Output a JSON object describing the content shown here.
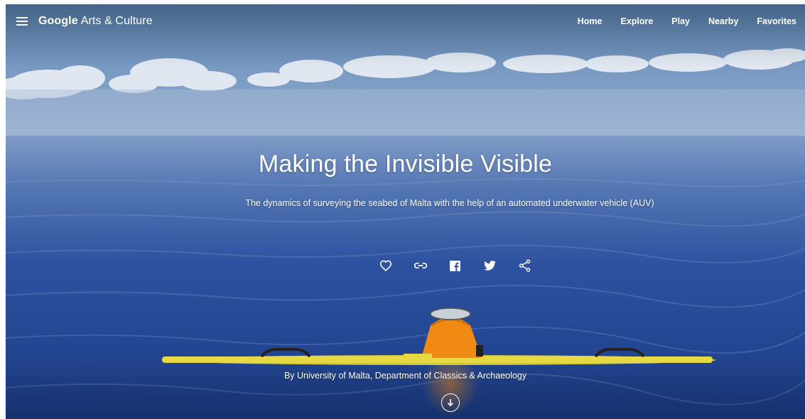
{
  "header": {
    "menu_icon": "hamburger-menu-icon",
    "logo_brand": "Google",
    "logo_product": "Arts & Culture",
    "nav": [
      {
        "label": "Home"
      },
      {
        "label": "Explore"
      },
      {
        "label": "Play"
      },
      {
        "label": "Nearby"
      },
      {
        "label": "Favorites"
      }
    ]
  },
  "story": {
    "title": "Making the Invisible Visible",
    "subtitle": "The dynamics of surveying the seabed of Malta with the help of an automated underwater vehicle (AUV)",
    "credit": "By University of Malta, Department of Classics & Archaeology"
  },
  "actions": [
    {
      "icon": "heart-icon",
      "label": "Favorite"
    },
    {
      "icon": "link-icon",
      "label": "Copy link"
    },
    {
      "icon": "facebook-icon",
      "label": "Share on Facebook"
    },
    {
      "icon": "twitter-icon",
      "label": "Share on Twitter"
    },
    {
      "icon": "share-icon",
      "label": "Share"
    }
  ],
  "scroll": {
    "icon": "arrow-down-icon"
  },
  "colors": {
    "sky_top": "#5f86b6",
    "sea_deep": "#1d3f86",
    "auv_orange": "#f08a12",
    "auv_yellow": "#e6d640",
    "text": "#ffffff"
  }
}
